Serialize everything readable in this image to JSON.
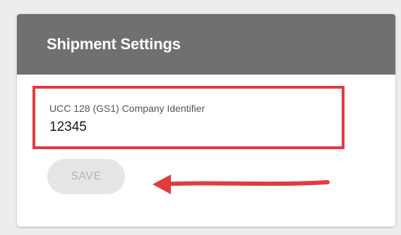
{
  "card": {
    "title": "Shipment Settings"
  },
  "field": {
    "label": "UCC 128 (GS1) Company Identifier",
    "value": "12345"
  },
  "actions": {
    "save_label": "SAVE"
  },
  "colors": {
    "header_bg": "#707070",
    "highlight_red": "#e23b3f",
    "button_bg": "#e6e6e6",
    "button_text": "#b4b4b4"
  },
  "annotations": {
    "highlight_box_target": "company-identifier-field",
    "arrow_icon": "left-arrow-icon"
  }
}
